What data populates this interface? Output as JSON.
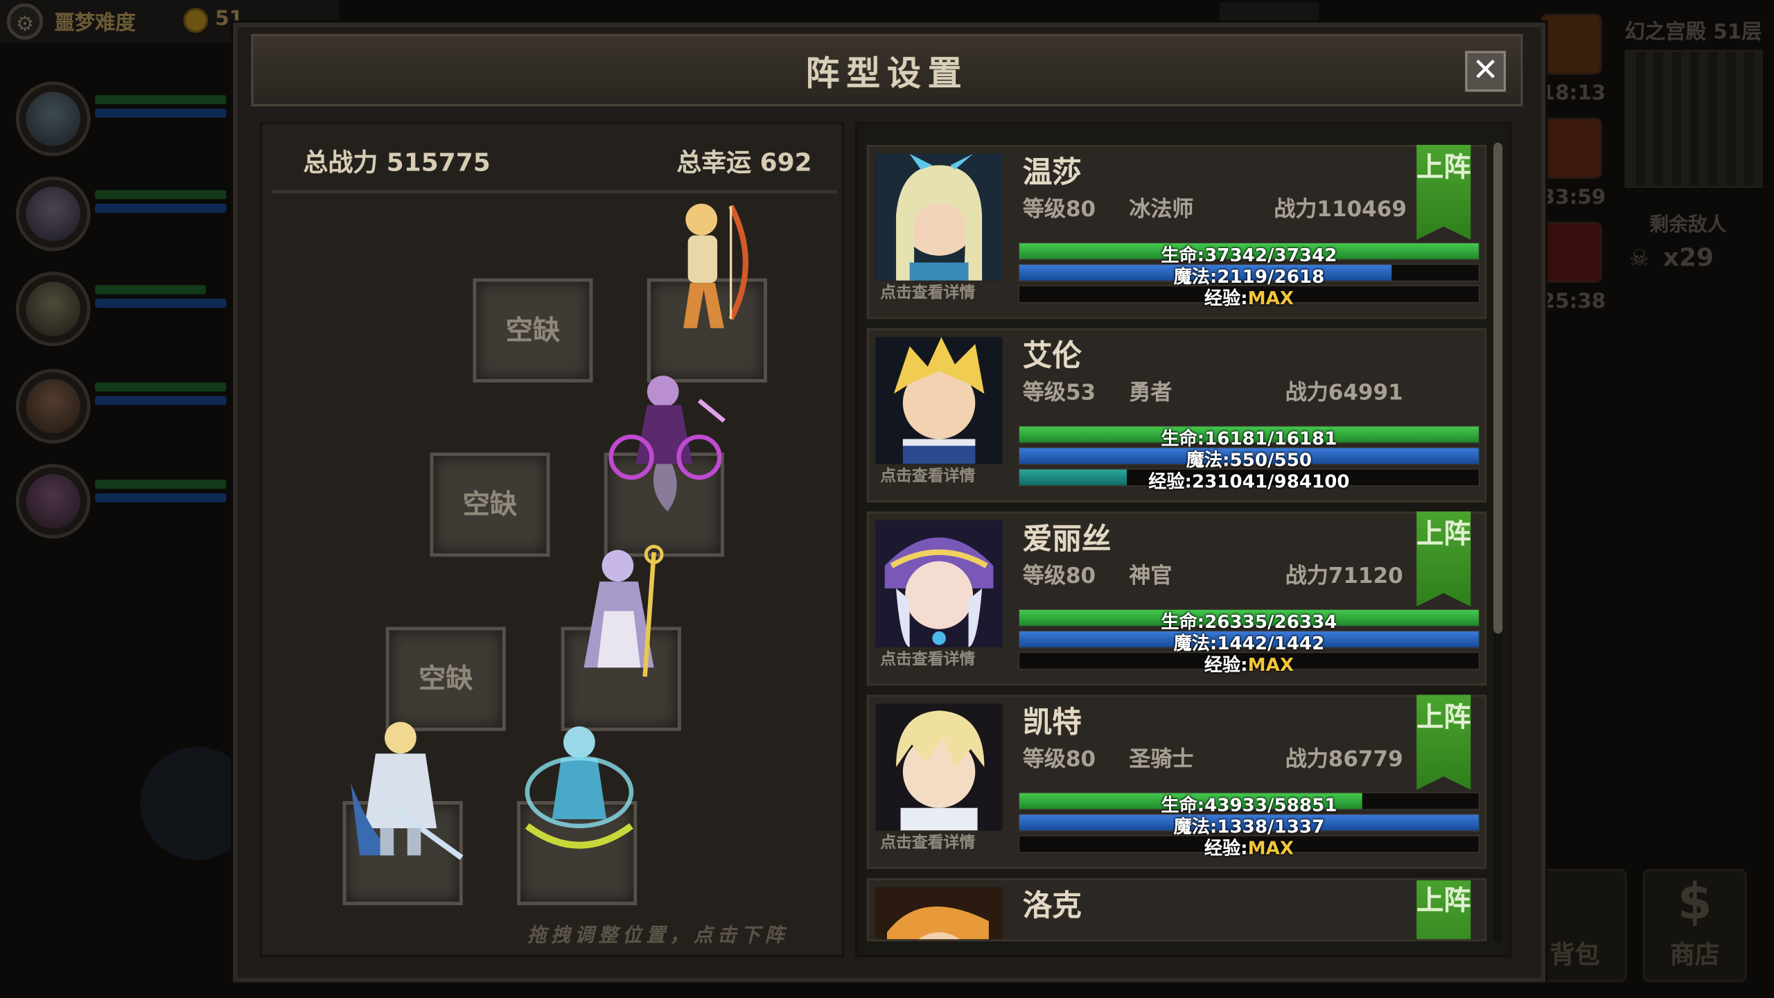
{
  "hud": {
    "difficulty": "噩梦难度",
    "gold": "51",
    "floor": "幻之宫殿 51层",
    "timers": [
      "18:13",
      "33:59",
      "25:38"
    ],
    "enemies_label": "剩余敌人",
    "enemies_count": "x29",
    "bag_label": "背包",
    "shop_label": "商店",
    "shop_icon": "$"
  },
  "dialog": {
    "title": "阵型设置",
    "close_symbol": "✕"
  },
  "formation": {
    "total_power": "总战力 515775",
    "total_luck": "总幸运 692",
    "empty_label": "空缺",
    "hint": "拖拽调整位置，点击下阵"
  },
  "heroes": [
    {
      "name": "温莎",
      "level": "等级80",
      "class": "冰法师",
      "power": "战力110469",
      "hp": "生命:37342/37342",
      "mp": "魔法:2119/2618",
      "exp_label": "经验:",
      "exp_value": "MAX",
      "detail": "点击查看详情",
      "action": "上阵",
      "hp_pct": 1.0,
      "mp_pct": 0.81,
      "exp_pct": 0
    },
    {
      "name": "艾伦",
      "level": "等级53",
      "class": "勇者",
      "power": "战力64991",
      "hp": "生命:16181/16181",
      "mp": "魔法:550/550",
      "exp_label": "经验:231041/984100",
      "exp_value": "",
      "detail": "点击查看详情",
      "action": "",
      "hp_pct": 1.0,
      "mp_pct": 1.0,
      "exp_pct": 0.235
    },
    {
      "name": "爱丽丝",
      "level": "等级80",
      "class": "神官",
      "power": "战力71120",
      "hp": "生命:26335/26334",
      "mp": "魔法:1442/1442",
      "exp_label": "经验:",
      "exp_value": "MAX",
      "detail": "点击查看详情",
      "action": "上阵",
      "hp_pct": 1.0,
      "mp_pct": 1.0,
      "exp_pct": 0
    },
    {
      "name": "凯特",
      "level": "等级80",
      "class": "圣骑士",
      "power": "战力86779",
      "hp": "生命:43933/58851",
      "mp": "魔法:1338/1337",
      "exp_label": "经验:",
      "exp_value": "MAX",
      "detail": "点击查看详情",
      "action": "上阵",
      "hp_pct": 0.746,
      "mp_pct": 1.0,
      "exp_pct": 0
    },
    {
      "name": "洛克",
      "action": "上阵"
    }
  ],
  "colors": {
    "hp": "#2fae3a",
    "mp": "#1f5fb8",
    "exp": "#1d8f86",
    "ribbon": "#3e9628",
    "max": "#f2c53a"
  }
}
